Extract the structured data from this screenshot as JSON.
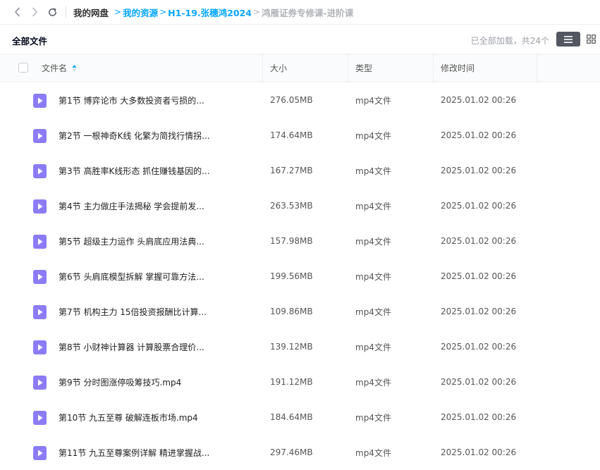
{
  "nav": {
    "back_icon": "chevron-left-icon",
    "forward_icon": "chevron-right-icon",
    "refresh_icon": "refresh-icon"
  },
  "breadcrumb": {
    "root": "我的网盘",
    "level1": "我的资源",
    "level2": "H1-19.张穗鸿2024",
    "current": "鸿雁证券专修课-进阶课",
    "separator": ">"
  },
  "toolbar": {
    "title": "全部文件",
    "loaded_text": "已全部加载，共24个",
    "list_view_icon": "list-view-icon",
    "grid_view_icon": "grid-view-icon"
  },
  "table": {
    "columns": {
      "name": "文件名",
      "size": "大小",
      "type": "类型",
      "modified": "修改时间"
    },
    "rows": [
      {
        "name": "第1节 博弈论市 大多数投资者亏损的...",
        "size": "276.05MB",
        "type": "mp4文件",
        "modified": "2025.01.02 00:26"
      },
      {
        "name": "第2节 一根神奇K线 化繁为简找行情拐...",
        "size": "174.64MB",
        "type": "mp4文件",
        "modified": "2025.01.02 00:26"
      },
      {
        "name": "第3节 高胜率K线形态 抓住赚钱基因的...",
        "size": "167.27MB",
        "type": "mp4文件",
        "modified": "2025.01.02 00:26"
      },
      {
        "name": "第4节 主力做庄手法揭秘 学会提前发...",
        "size": "263.53MB",
        "type": "mp4文件",
        "modified": "2025.01.02 00:26"
      },
      {
        "name": "第5节 超级主力运作 头肩底应用法典...",
        "size": "157.98MB",
        "type": "mp4文件",
        "modified": "2025.01.02 00:26"
      },
      {
        "name": "第6节 头肩底模型拆解 掌握可靠方法...",
        "size": "199.56MB",
        "type": "mp4文件",
        "modified": "2025.01.02 00:26"
      },
      {
        "name": "第7节 机构主力 15倍投资报酬比计算...",
        "size": "109.86MB",
        "type": "mp4文件",
        "modified": "2025.01.02 00:26"
      },
      {
        "name": "第8节 小财神计算器 计算股票合理价...",
        "size": "139.12MB",
        "type": "mp4文件",
        "modified": "2025.01.02 00:26"
      },
      {
        "name": "第9节 分时图涨停吸筹技巧.mp4",
        "size": "191.12MB",
        "type": "mp4文件",
        "modified": "2025.01.02 00:26"
      },
      {
        "name": "第10节 九五至尊 破解连板市场.mp4",
        "size": "184.64MB",
        "type": "mp4文件",
        "modified": "2025.01.02 00:26"
      },
      {
        "name": "第11节 九五至尊案例详解 精进掌握战...",
        "size": "297.46MB",
        "type": "mp4文件",
        "modified": "2025.01.02 00:26"
      }
    ],
    "row_icon": "video-file-icon",
    "sort_icon": "sort-ascending-icon"
  },
  "colors": {
    "accent": "#06a7ff",
    "video_icon": "#8b7cf6",
    "current_crumb": "#b0b3b8"
  }
}
